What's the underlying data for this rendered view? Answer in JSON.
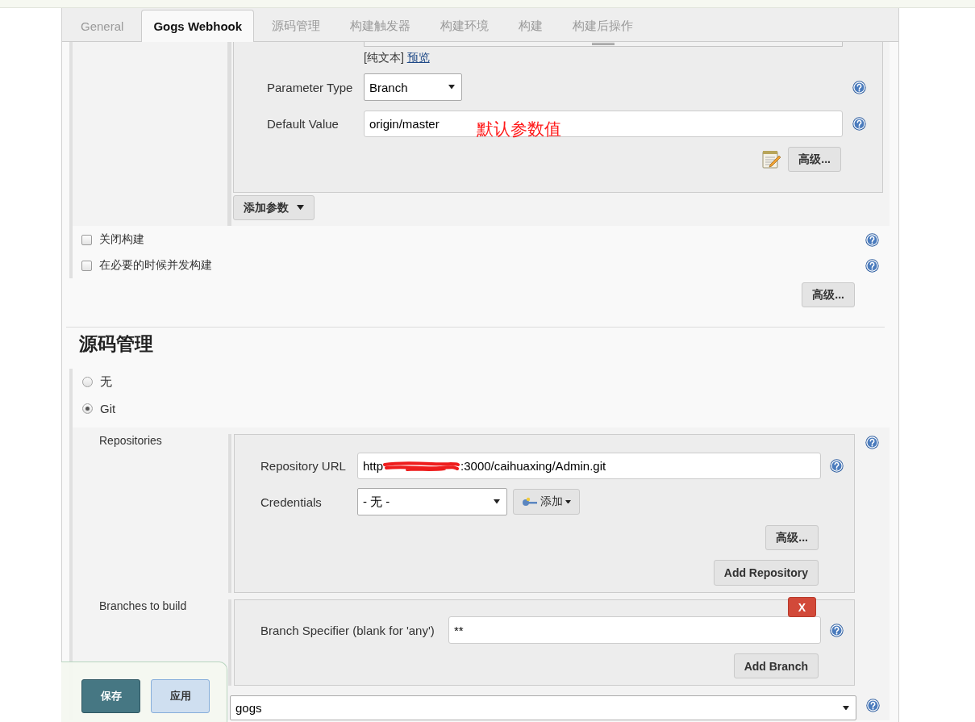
{
  "tabs": [
    {
      "label": "General",
      "selected": false
    },
    {
      "label": "Gogs Webhook",
      "selected": true
    },
    {
      "label": "源码管理",
      "selected": false
    },
    {
      "label": "构建触发器",
      "selected": false
    },
    {
      "label": "构建环境",
      "selected": false
    },
    {
      "label": "构建",
      "selected": false
    },
    {
      "label": "构建后操作",
      "selected": false
    }
  ],
  "parameter": {
    "format_label": "[纯文本]",
    "preview_link": "预览",
    "parameter_type": {
      "label": "Parameter Type",
      "value": "Branch"
    },
    "default_value": {
      "label": "Default Value",
      "value": "origin/master",
      "annotation": "默认参数值"
    },
    "advanced_button": "高级..."
  },
  "add_parameter_button": "添加参数",
  "options": [
    {
      "label": "关闭构建",
      "checked": false
    },
    {
      "label": "在必要的时候并发构建",
      "checked": false
    }
  ],
  "advanced_button": "高级...",
  "scm": {
    "heading": "源码管理",
    "choices": [
      {
        "label": "无",
        "selected": false
      },
      {
        "label": "Git",
        "selected": true
      }
    ],
    "repositories": {
      "label": "Repositories",
      "url": {
        "label": "Repository URL",
        "visible_start": "http",
        "redacted": true,
        "visible_end": ":3000/caihuaxing/Admin.git"
      },
      "credentials": {
        "label": "Credentials",
        "value": "- 无 -",
        "add_button": "添加"
      },
      "advanced_button": "高级...",
      "add_button": "Add Repository"
    },
    "branches": {
      "label": "Branches to build",
      "delete_button": "X",
      "specifier": {
        "label": "Branch Specifier (blank for 'any')",
        "value": "**"
      },
      "add_button": "Add Branch"
    },
    "browser": {
      "value": "gogs"
    }
  },
  "save_bar": {
    "save_button": "保存",
    "apply_button": "应用"
  }
}
